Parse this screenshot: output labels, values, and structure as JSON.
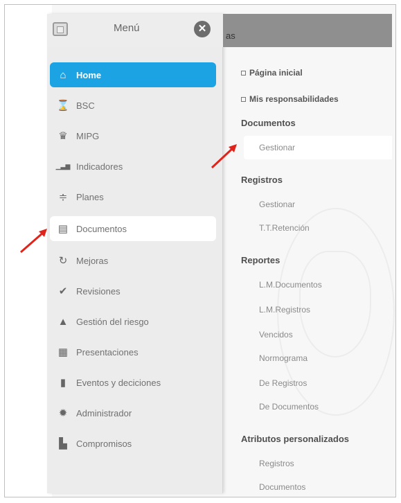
{
  "sidebar": {
    "title": "Menú",
    "close_glyph": "✕",
    "items": [
      {
        "label": "Home",
        "icon": "home-icon",
        "glyph": "⌂"
      },
      {
        "label": "BSC",
        "icon": "hourglass-icon",
        "glyph": "⌛"
      },
      {
        "label": "MIPG",
        "icon": "award-icon",
        "glyph": "♛"
      },
      {
        "label": "Indicadores",
        "icon": "bar-chart-icon",
        "glyph": "▁▃▆"
      },
      {
        "label": "Planes",
        "icon": "sliders-icon",
        "glyph": "≑"
      },
      {
        "label": "Documentos",
        "icon": "database-icon",
        "glyph": "▤"
      },
      {
        "label": "Mejoras",
        "icon": "refresh-icon",
        "glyph": "↻"
      },
      {
        "label": "Revisiones",
        "icon": "check-circle-icon",
        "glyph": "✔"
      },
      {
        "label": "Gestión del riesgo",
        "icon": "warning-icon",
        "glyph": "▲"
      },
      {
        "label": "Presentaciones",
        "icon": "presentation-icon",
        "glyph": "▦"
      },
      {
        "label": "Eventos y deciciones",
        "icon": "lock-icon",
        "glyph": "▮"
      },
      {
        "label": "Administrador",
        "icon": "gear-icon",
        "glyph": "✹"
      },
      {
        "label": "Compromisos",
        "icon": "building-icon",
        "glyph": "▙"
      }
    ]
  },
  "header": {
    "text": "as"
  },
  "panel": {
    "links": [
      {
        "label": "Página inicial"
      },
      {
        "label": "Mis responsabilidades"
      }
    ],
    "documentos": {
      "title": "Documentos",
      "items": [
        "Gestionar"
      ]
    },
    "registros": {
      "title": "Registros",
      "items": [
        "Gestionar",
        "T.T.Retención"
      ]
    },
    "reportes": {
      "title": "Reportes",
      "items": [
        "L.M.Documentos",
        "L.M.Registros",
        "Vencidos",
        "Normograma",
        "De Registros",
        "De Documentos"
      ]
    },
    "atributos": {
      "title": "Atributos personalizados",
      "items": [
        "Registros",
        "Documentos"
      ]
    }
  },
  "colors": {
    "accent": "#1ba3e4",
    "arrow": "#e0241b"
  }
}
